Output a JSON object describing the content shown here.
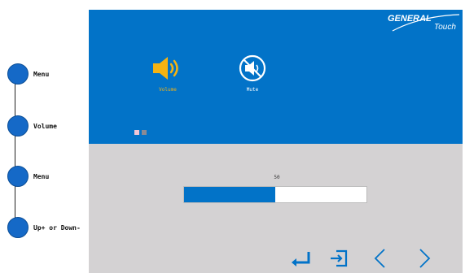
{
  "callouts": [
    {
      "label": "Menu"
    },
    {
      "label": "Volume"
    },
    {
      "label": "Menu"
    },
    {
      "label": "Up+ or Down-"
    }
  ],
  "logo": {
    "line1": "GENERAL",
    "line2": "Touch"
  },
  "menu": {
    "items": [
      {
        "label": "Volume",
        "icon": "volume-icon",
        "selected": true
      },
      {
        "label": "Mute",
        "icon": "mute-icon",
        "selected": false
      }
    ],
    "page_indicator": {
      "pages": 2,
      "current": 1
    }
  },
  "volume": {
    "value_text": "50",
    "level_percent": 50
  },
  "nav": {
    "buttons": [
      {
        "icon": "enter-icon"
      },
      {
        "icon": "exit-icon"
      },
      {
        "icon": "chevron-left-icon"
      },
      {
        "icon": "chevron-right-icon"
      }
    ]
  },
  "colors": {
    "osd_blue": "#0273c8",
    "osd_gray": "#d4d2d3",
    "selected_yellow": "#f5b312",
    "callout_blue": "#1569c7"
  }
}
